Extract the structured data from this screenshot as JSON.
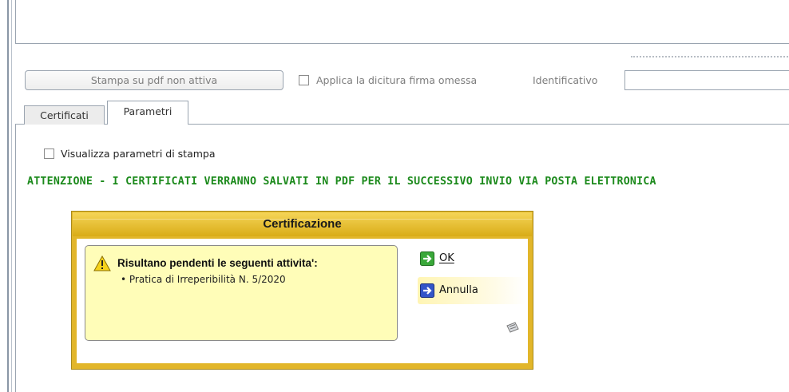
{
  "toolbar": {
    "print_button_label": "Stampa su pdf non attiva",
    "omit_signature_label": "Applica la dicitura firma omessa",
    "identifier_label": "Identificativo",
    "identifier_value": ""
  },
  "tabs": [
    {
      "label": "Certificati",
      "active": false
    },
    {
      "label": "Parametri",
      "active": true
    }
  ],
  "parameters": {
    "show_print_params_label": "Visualizza parametri di stampa",
    "warning_text": "ATTENZIONE - I CERTIFICATI VERRANNO SALVATI IN PDF PER IL SUCCESSIVO INVIO VIA POSTA ELETTRONICA"
  },
  "dialog": {
    "title": "Certificazione",
    "message_title": "Risultano pendenti le seguenti attivita':",
    "items": [
      "• Pratica di Irreperibilità N. 5/2020"
    ],
    "ok_label": "OK",
    "cancel_label": "Annulla",
    "icons": {
      "warning": "warning-icon",
      "ok": "arrow-right-icon",
      "cancel": "arrow-right-icon",
      "note": "note-icon"
    }
  },
  "colors": {
    "warning_text": "#1c8a1c",
    "dialog_frame": "#e2b62a",
    "message_bg": "#fffdb8"
  }
}
